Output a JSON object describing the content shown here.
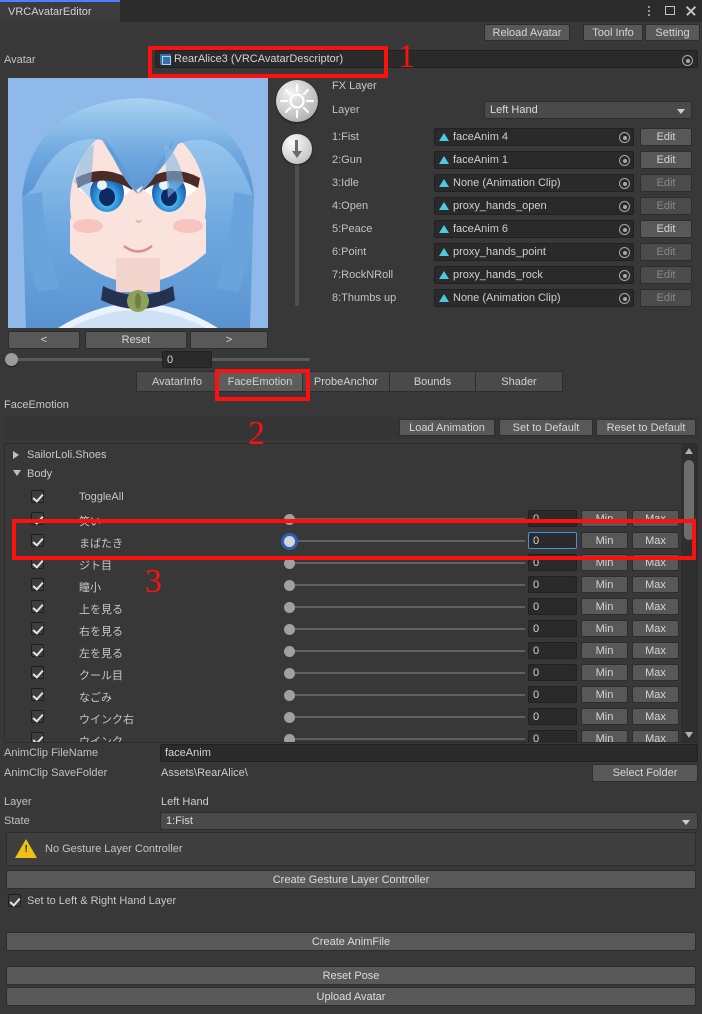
{
  "window": {
    "tab_title": "VRCAvatarEditor",
    "controls": {
      "menu": "menu-dots",
      "maximize": "maximize",
      "close": "close"
    }
  },
  "toolbar": {
    "reload_avatar": "Reload Avatar",
    "tool_info": "Tool Info",
    "setting": "Setting"
  },
  "avatar_field": {
    "label": "Avatar",
    "value": "RearAlice3 (VRCAvatarDescriptor)"
  },
  "preview": {
    "prev_label": "<",
    "reset_label": "Reset",
    "next_label": ">",
    "zoom_value": "0"
  },
  "fx_layer": {
    "title": "FX Layer",
    "layer_label": "Layer",
    "layer_value": "Left Hand",
    "rows": [
      {
        "name": "1:Fist",
        "clip": "faceAnim 4",
        "edit": "Edit",
        "edit_enabled": true
      },
      {
        "name": "2:Gun",
        "clip": "faceAnim 1",
        "edit": "Edit",
        "edit_enabled": true
      },
      {
        "name": "3:Idle",
        "clip": "None (Animation Clip)",
        "edit": "Edit",
        "edit_enabled": false
      },
      {
        "name": "4:Open",
        "clip": "proxy_hands_open",
        "edit": "Edit",
        "edit_enabled": false
      },
      {
        "name": "5:Peace",
        "clip": "faceAnim 6",
        "edit": "Edit",
        "edit_enabled": true
      },
      {
        "name": "6:Point",
        "clip": "proxy_hands_point",
        "edit": "Edit",
        "edit_enabled": false
      },
      {
        "name": "7:RockNRoll",
        "clip": "proxy_hands_rock",
        "edit": "Edit",
        "edit_enabled": false
      },
      {
        "name": "8:Thumbs up",
        "clip": "None (Animation Clip)",
        "edit": "Edit",
        "edit_enabled": false
      }
    ]
  },
  "tabs": [
    {
      "label": "AvatarInfo",
      "active": false
    },
    {
      "label": "FaceEmotion",
      "active": true
    },
    {
      "label": "ProbeAnchor",
      "active": false
    },
    {
      "label": "Bounds",
      "active": false
    },
    {
      "label": "Shader",
      "active": false
    }
  ],
  "section": {
    "title": "FaceEmotion",
    "load_animation": "Load Animation",
    "set_to_default": "Set to Default",
    "reset_to_default": "Reset to Default"
  },
  "blendshape_list": {
    "groups": [
      {
        "name": "SailorLoli.Shoes",
        "expanded": false
      },
      {
        "name": "Body",
        "expanded": true
      }
    ],
    "toggle_all": {
      "label": "ToggleAll",
      "checked": true
    },
    "min_label": "Min",
    "max_label": "Max",
    "items": [
      {
        "name": "笑い",
        "checked": true,
        "value": "0",
        "focused": false
      },
      {
        "name": "まばたき",
        "checked": true,
        "value": "0",
        "focused": true
      },
      {
        "name": "ジト目",
        "checked": true,
        "value": "0",
        "focused": false
      },
      {
        "name": "瞳小",
        "checked": true,
        "value": "0",
        "focused": false
      },
      {
        "name": "上を見る",
        "checked": true,
        "value": "0",
        "focused": false
      },
      {
        "name": "右を見る",
        "checked": true,
        "value": "0",
        "focused": false
      },
      {
        "name": "左を見る",
        "checked": true,
        "value": "0",
        "focused": false
      },
      {
        "name": "クール目",
        "checked": true,
        "value": "0",
        "focused": false
      },
      {
        "name": "なごみ",
        "checked": true,
        "value": "0",
        "focused": false
      },
      {
        "name": "ウインク右",
        "checked": true,
        "value": "0",
        "focused": false
      },
      {
        "name": "ウインク",
        "checked": true,
        "value": "0",
        "focused": false
      }
    ]
  },
  "form": {
    "filename_label": "AnimClip FileName",
    "filename_value": "faceAnim",
    "savefolder_label": "AnimClip SaveFolder",
    "savefolder_value": "Assets\\RearAlice\\",
    "select_folder": "Select Folder",
    "layer_label": "Layer",
    "layer_value": "Left Hand",
    "state_label": "State",
    "state_value": "1:Fist"
  },
  "helpbox": {
    "text": "No Gesture Layer Controller"
  },
  "actions": {
    "create_gesture_layer_controller": "Create Gesture Layer Controller",
    "set_to_left_right_hand_layer": "Set to Left & Right Hand Layer",
    "set_to_left_right_hand_layer_checked": true,
    "create_animfile": "Create AnimFile",
    "reset_pose": "Reset Pose",
    "upload_avatar": "Upload Avatar"
  },
  "annotations": [
    {
      "id": "1",
      "number": "1"
    },
    {
      "id": "2",
      "number": "2"
    },
    {
      "id": "3",
      "number": "3"
    }
  ],
  "colors": {
    "accent_blue": "#4c7eff",
    "annotation_red": "#fc1111",
    "panel_bg": "#383838",
    "warning_yellow": "#f2c014"
  }
}
